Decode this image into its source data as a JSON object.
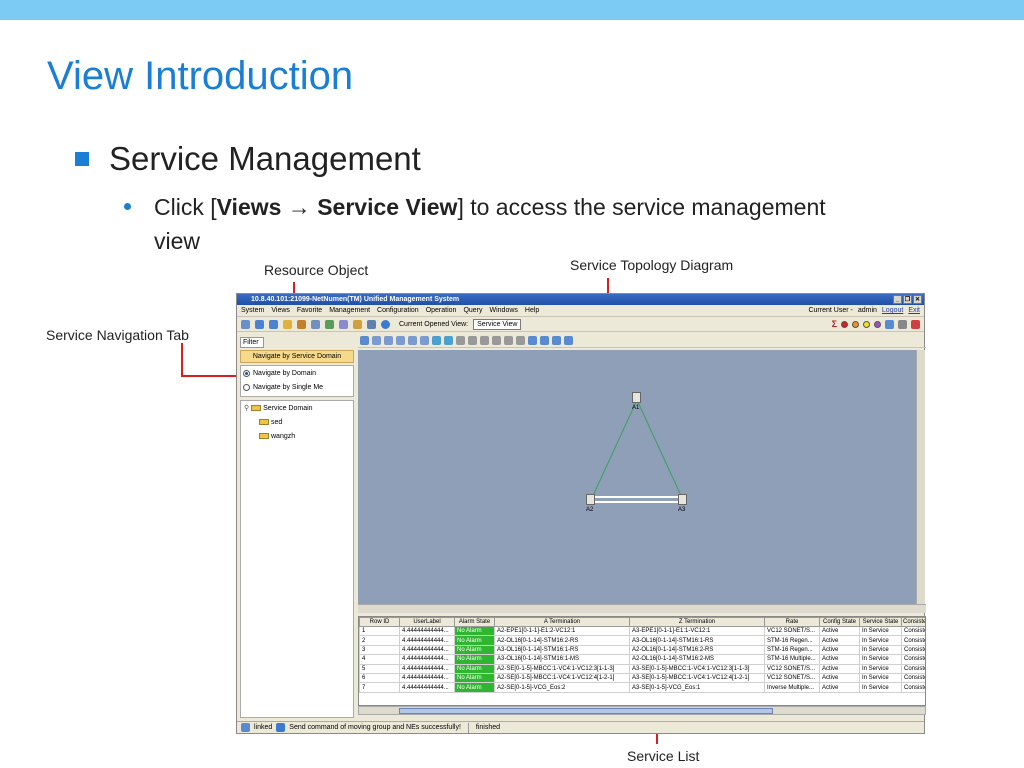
{
  "slide": {
    "title": "View Introduction",
    "bullet1": "Service Management",
    "bullet2_prefix": "Click [",
    "bullet2_views": "Views",
    "bullet2_arrow": " → ",
    "bullet2_service_view": "Service View",
    "bullet2_suffix": "] to access the service management view"
  },
  "callouts": {
    "resource_object": "Resource Object",
    "service_topology": "Service Topology Diagram",
    "service_nav_tab": "Service Navigation Tab",
    "service_list": "Service List"
  },
  "app": {
    "title": "10.8.40.101:21099-NetNumen(TM) Unified Management System",
    "menu": [
      "System",
      "Views",
      "Favorite",
      "Management",
      "Configuration",
      "Operation",
      "Query",
      "Windows",
      "Help"
    ],
    "current_user_label": "Current User -",
    "current_user": "admin",
    "logout": "Logout",
    "exit": "Exit",
    "current_opened_view_label": "Current Opened View:",
    "current_opened_view": "Service View"
  },
  "left_panel": {
    "filter_tab": "Filter",
    "nav_tab": "Navigate by Service Domain",
    "radio_domain": "Navigate by Domain",
    "radio_single": "Navigate by Single Me",
    "tree_root": "Service Domain",
    "tree_children": [
      "sed",
      "wangzh"
    ]
  },
  "topology": {
    "nodes": [
      "A1",
      "A2",
      "A3"
    ]
  },
  "table": {
    "headers": [
      "Row ID",
      "UserLabel",
      "Alarm State",
      "A Termination",
      "Z Termination",
      "Rate",
      "Config State",
      "Service State",
      "Consiste"
    ],
    "rows": [
      [
        "1",
        "4.44444444444...",
        "No Alarm",
        "A2-EPE1[0-1-1]-E1:2-VC12:1",
        "A3-EPE1[0-1-1]-E1:1-VC12:1",
        "VC12 SONET/S...",
        "Active",
        "In Service",
        "Consiste"
      ],
      [
        "2",
        "4.44444444444...",
        "No Alarm",
        "A2-OL16[0-1-14]-STM16:2-RS",
        "A3-OL16[0-1-14]-STM16:1-RS",
        "STM-16 Regen...",
        "Active",
        "In Service",
        "Consiste"
      ],
      [
        "3",
        "4.44444444444...",
        "No Alarm",
        "A3-OL16[0-1-14]-STM16:1-RS",
        "A2-OL16[0-1-14]-STM16:2-RS",
        "STM-16 Regen...",
        "Active",
        "In Service",
        "Consiste"
      ],
      [
        "4",
        "4.44444444444...",
        "No Alarm",
        "A3-OL16[0-1-14]-STM16:1-MS",
        "A2-OL16[0-1-14]-STM16:2-MS",
        "STM-16 Multiple...",
        "Active",
        "In Service",
        "Consiste"
      ],
      [
        "5",
        "4.44444444444...",
        "No Alarm",
        "A2-SE[0-1-5]-MBCC:1-VC4:1-VC12:3[1-1-3]",
        "A3-SE[0-1-5]-MBCC:1-VC4:1-VC12:3[1-1-3]",
        "VC12 SONET/S...",
        "Active",
        "In Service",
        "Consiste"
      ],
      [
        "6",
        "4.44444444444...",
        "No Alarm",
        "A2-SE[0-1-5]-MBCC:1-VC4:1-VC12:4[1-2-1]",
        "A3-SE[0-1-5]-MBCC:1-VC4:1-VC12:4[1-2-1]",
        "VC12 SONET/S...",
        "Active",
        "In Service",
        "Consiste"
      ],
      [
        "7",
        "4.44444444444...",
        "No Alarm",
        "A2-SE[0-1-5]-VCG_Eos:2",
        "A3-SE[0-1-5]-VCG_Eos:1",
        "Inverse Multiple...",
        "Active",
        "In Service",
        "Consiste"
      ]
    ]
  },
  "statusbar": {
    "linked": "linked",
    "message": "Send command of moving group and NEs successfully!",
    "finished": "finished"
  },
  "colors": {
    "accent": "#1a7fd4",
    "callout_line": "#d62020",
    "alarm_ok": "#2fb52f",
    "canvas": "#8f9fb8"
  }
}
